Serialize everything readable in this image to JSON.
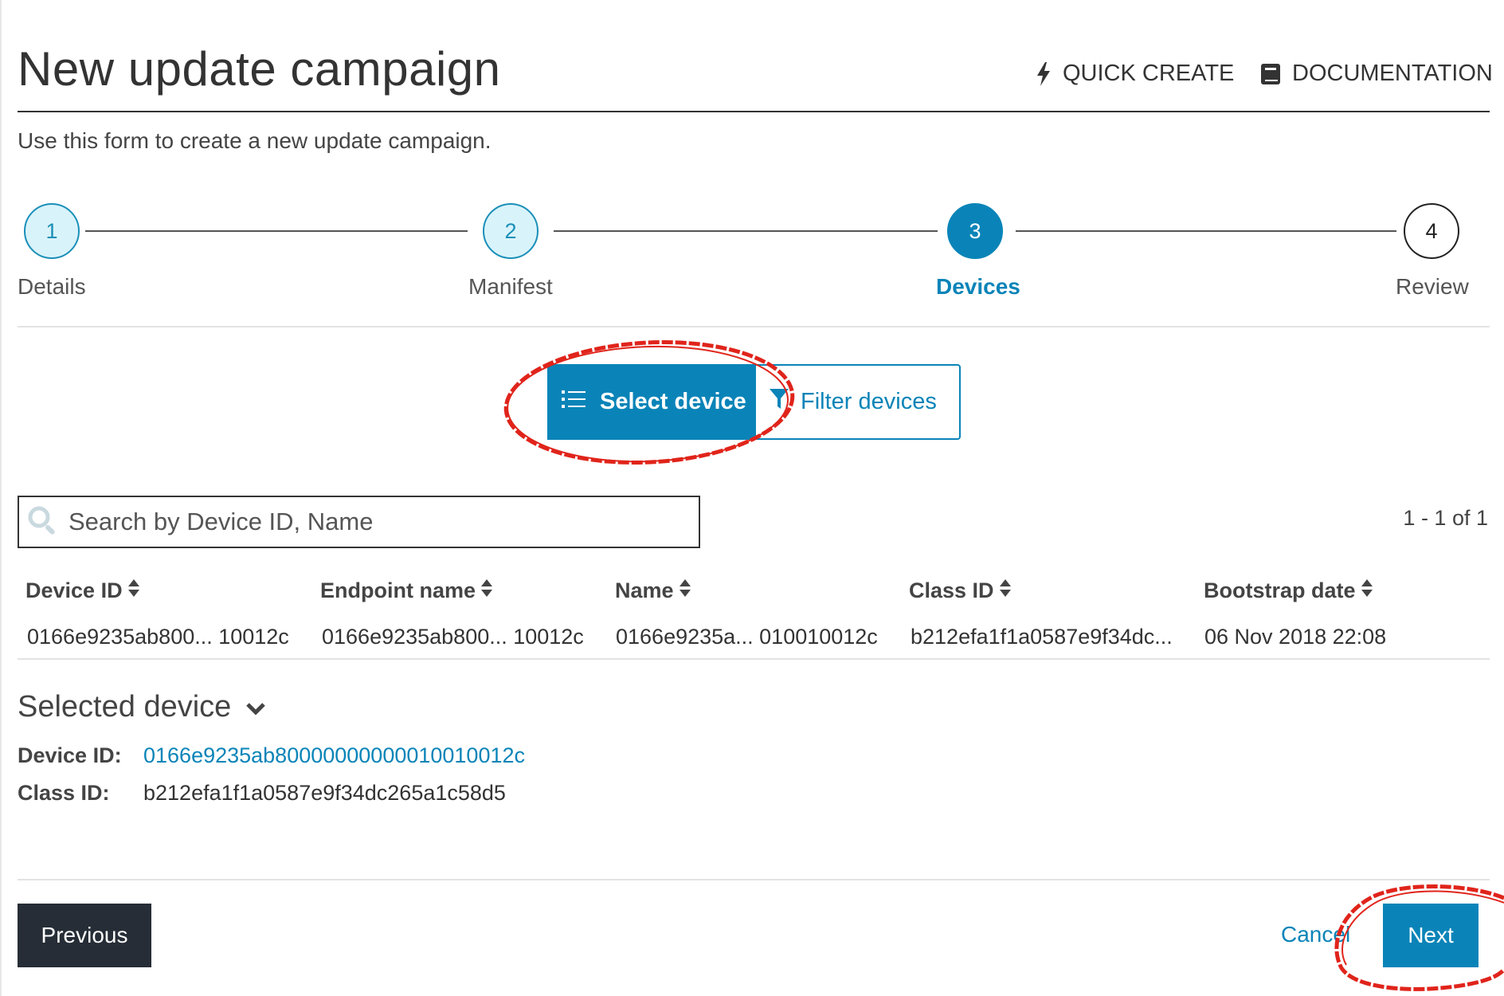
{
  "header": {
    "title": "New update campaign",
    "quick_create_label": "QUICK CREATE",
    "documentation_label": "DOCUMENTATION",
    "subtitle": "Use this form to create a new update campaign."
  },
  "stepper": {
    "current_step": 3,
    "steps": [
      {
        "number": "1",
        "label": "Details",
        "state": "done"
      },
      {
        "number": "2",
        "label": "Manifest",
        "state": "done"
      },
      {
        "number": "3",
        "label": "Devices",
        "state": "active"
      },
      {
        "number": "4",
        "label": "Review",
        "state": "todo"
      }
    ]
  },
  "device_mode": {
    "select_label": "Select device",
    "filter_label": "Filter devices",
    "selected": "Select device"
  },
  "search": {
    "placeholder": "Search by Device ID, Name",
    "value": ""
  },
  "pagination": {
    "text": "1 - 1 of 1"
  },
  "table": {
    "columns": [
      "Device ID",
      "Endpoint name",
      "Name",
      "Class ID",
      "Bootstrap date"
    ],
    "rows": [
      [
        "0166e9235ab800... 10012c",
        "0166e9235ab800... 10012c",
        "0166e9235a... 010010012c",
        "b212efa1f1a0587e9f34dc...",
        "06 Nov 2018 22:08"
      ]
    ]
  },
  "selected_device": {
    "title": "Selected device",
    "device_id_label": "Device ID:",
    "device_id_value": "0166e9235ab80000000000010010012c",
    "class_id_label": "Class ID:",
    "class_id_value": "b212efa1f1a0587e9f34dc265a1c58d5"
  },
  "footer": {
    "previous_label": "Previous",
    "cancel_label": "Cancel",
    "next_label": "Next"
  },
  "colors": {
    "accent": "#0a84b8",
    "step_done_fill": "#d9f3fa",
    "dark_button": "#262d36",
    "annotation_red": "#e0241b"
  },
  "icons": {
    "quick_create": "lightning-bolt-icon",
    "documentation": "book-icon",
    "select_device": "list-icon",
    "filter_devices": "filter-funnel-icon",
    "search": "magnifier-icon",
    "sort": "sort-updown-icon",
    "collapse": "chevron-down-icon"
  }
}
